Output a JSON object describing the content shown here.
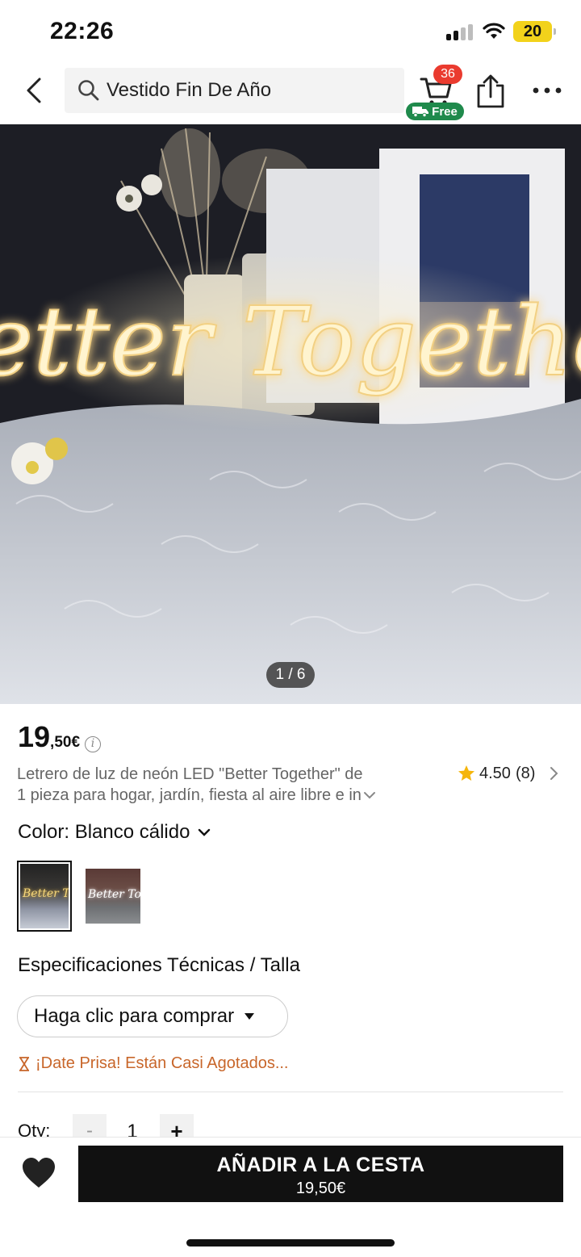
{
  "status_bar": {
    "time": "22:26",
    "battery": "20"
  },
  "nav": {
    "search_query": "Vestido Fin De Año",
    "cart_count": "36",
    "free_label": "Free"
  },
  "gallery": {
    "counter": "1 / 6",
    "neon_text": "Better Together"
  },
  "product": {
    "price_int": "19",
    "price_dec": ",50€",
    "title_line1": "Letrero de luz de neón LED \"Better Together\" de",
    "title_line2": "1 pieza para hogar, jardín, fiesta al aire libre e in",
    "rating": "4.50",
    "reviews": "(8)",
    "color_label": "Color: Blanco cálido",
    "spec_heading": "Especificaciones Técnicas / Talla",
    "buy_select_label": "Haga clic para comprar",
    "hurry_text": "¡Date Prisa! Están Casi Agotados...",
    "qty_label": "Qty:",
    "qty_minus": "-",
    "qty_value": "1",
    "qty_plus": "+"
  },
  "bottom_bar": {
    "add_label": "AÑADIR A LA CESTA",
    "add_price": "19,50€"
  },
  "icons": [
    "back-icon",
    "search-icon",
    "cart-icon",
    "truck-icon",
    "share-icon",
    "more-icon",
    "info-icon",
    "star-icon",
    "chevron-right-icon",
    "chevron-down-icon",
    "hourglass-icon",
    "heart-icon"
  ],
  "colors": {
    "accent_dark": "#111111",
    "badge_red": "#ea3b2f",
    "free_green": "#1f8a4c",
    "hurry_orange": "#c8662a",
    "star_yellow": "#f5b50a"
  }
}
